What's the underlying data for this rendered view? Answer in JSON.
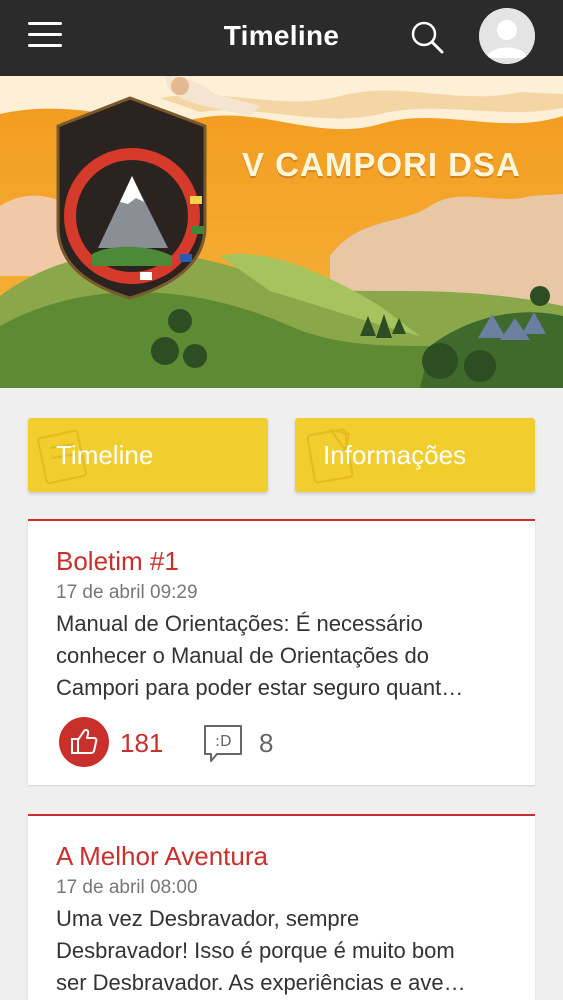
{
  "header": {
    "title": "Timeline",
    "menu_icon": "hamburger-menu-icon",
    "search_icon": "search-icon",
    "avatar_icon": "user-avatar-icon"
  },
  "banner": {
    "title": "V CAMPORI DSA"
  },
  "buttons": {
    "timeline_label": "Timeline",
    "info_label": "Informações"
  },
  "posts": [
    {
      "title": "Boletim #1",
      "date": "17 de abril 09:29",
      "body_lines": [
        "Manual de Orientações: É necessário",
        "conhecer o Manual de Orientações do",
        "Campori para poder estar seguro quant…"
      ],
      "likes": "181",
      "comments": "8"
    },
    {
      "title": "A Melhor Aventura",
      "date": "17 de abril 08:00",
      "body_lines": [
        "Uma vez Desbravador, sempre",
        "Desbravador! Isso é porque é muito bom",
        "ser Desbravador. As experiências e ave…"
      ]
    }
  ],
  "colors": {
    "topbar": "#2b2b2b",
    "accent_red": "#c9302c",
    "button_yellow": "#f1cd2e",
    "background": "#efefef"
  }
}
